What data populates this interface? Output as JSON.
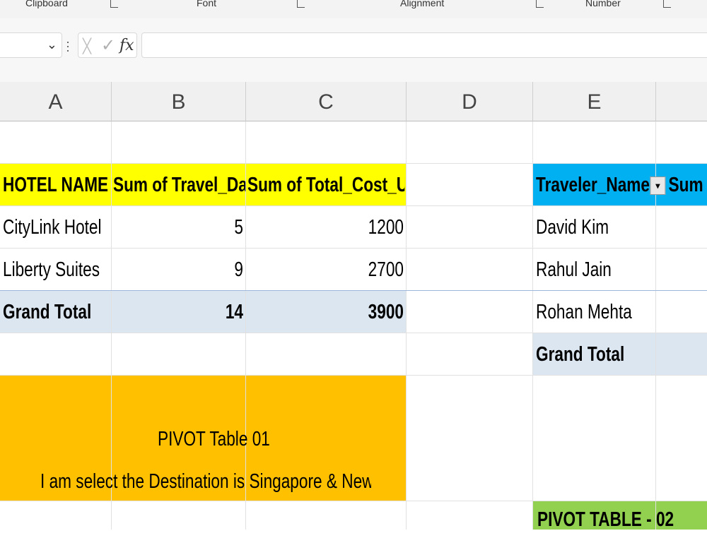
{
  "ribbon": {
    "groups": [
      "Clipboard",
      "Font",
      "Alignment",
      "Number"
    ]
  },
  "formula_bar": {
    "name_box": "",
    "cancel_symbol": "╳",
    "enter_symbol": "✓",
    "fx_symbol": "fx",
    "value": ""
  },
  "columns": [
    "A",
    "B",
    "C",
    "D",
    "E"
  ],
  "pivot1": {
    "headers": [
      "HOTEL NAME",
      "Sum of Travel_Days",
      "Sum of Total_Cost_USD"
    ],
    "rows": [
      [
        "CityLink Hotel",
        "5",
        "1200"
      ],
      [
        "Liberty Suites",
        "9",
        "2700"
      ]
    ],
    "grand_total": [
      "Grand Total",
      "14",
      "3900"
    ],
    "header_color": "#ffff00",
    "total_color": "#dce6f1"
  },
  "note": {
    "line1": "PIVOT Table 01",
    "line2": "I am select the Destination is Singapore & Newyork",
    "color": "#ffc000"
  },
  "pivot2": {
    "headers": [
      "Traveler_Name",
      "Sum of I"
    ],
    "rows": [
      "David Kim",
      "Rahul Jain",
      "Rohan Mehta"
    ],
    "grand_total": "Grand Total",
    "header_color": "#00b0f0",
    "title": "PIVOT TABLE - 02",
    "title_color": "#92d050"
  }
}
